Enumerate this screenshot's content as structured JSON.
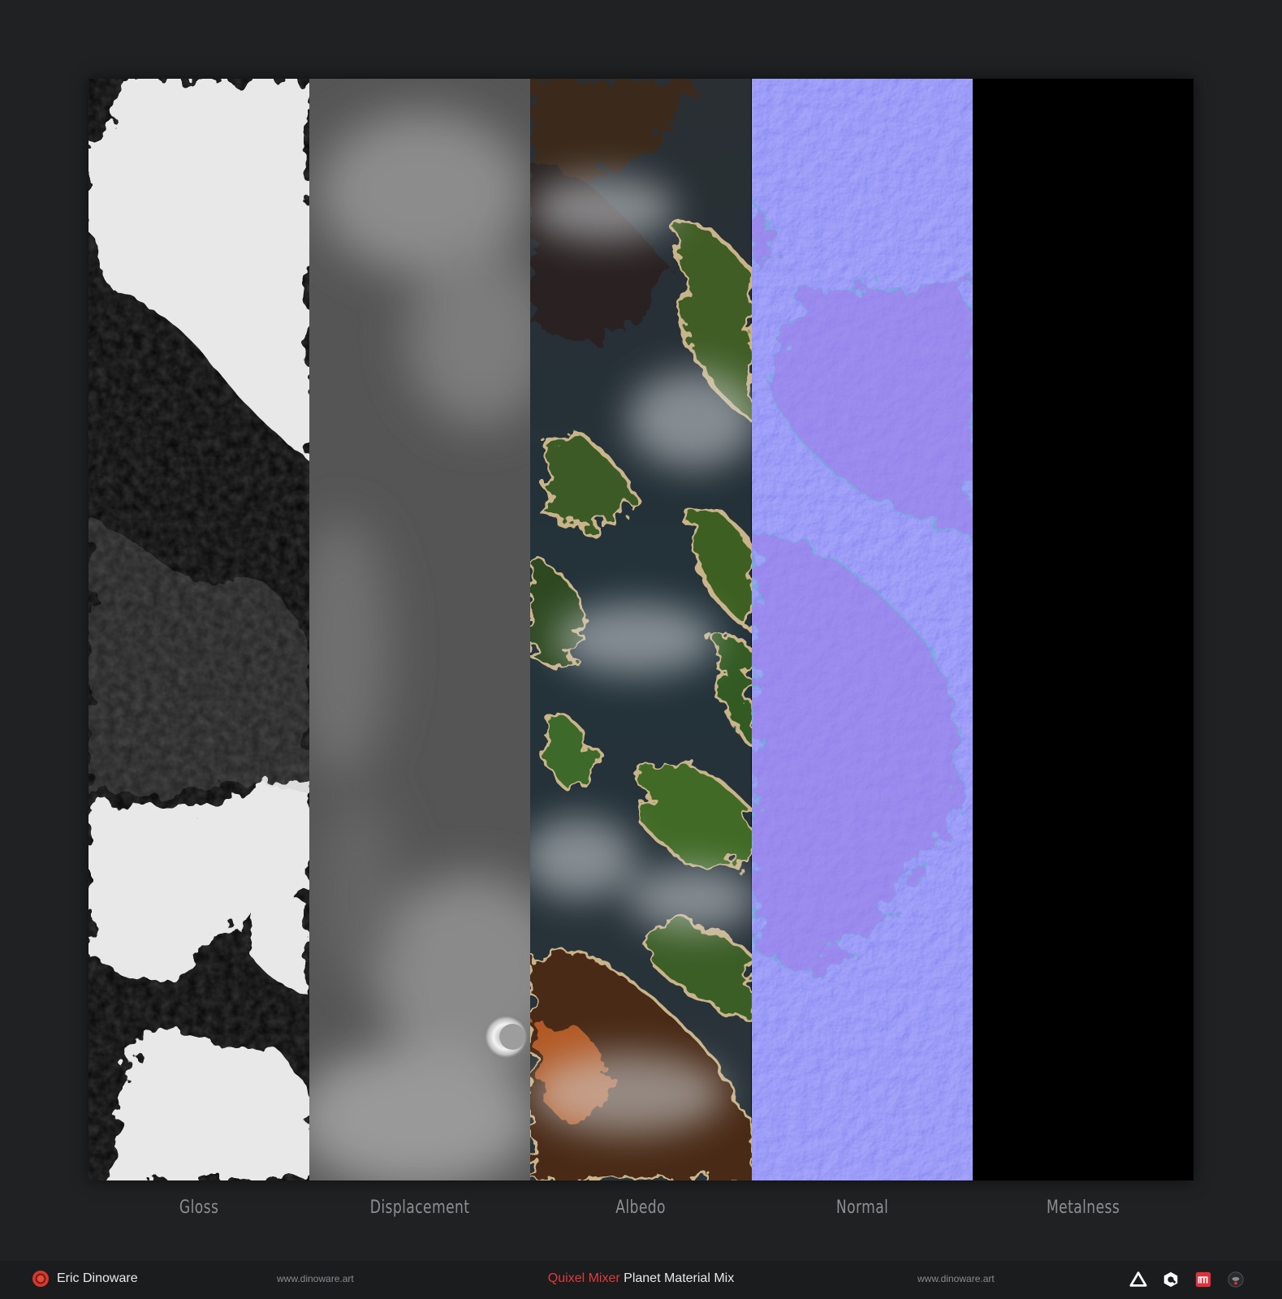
{
  "maps": [
    {
      "label": "Gloss",
      "icon": "gloss-map"
    },
    {
      "label": "Displacement",
      "icon": "displacement-map"
    },
    {
      "label": "Albedo",
      "icon": "albedo-map"
    },
    {
      "label": "Normal",
      "icon": "normal-map"
    },
    {
      "label": "Metalness",
      "icon": "metalness-map"
    }
  ],
  "footer": {
    "author": "Eric Dinoware",
    "url_left": "www.dinoware.art",
    "title_accent": "Quixel Mixer",
    "title_rest": " Planet Material Mix",
    "url_right": "www.dinoware.art",
    "icons": [
      "artstation-icon",
      "quixel-icon",
      "marmoset-icon",
      "dinoware-logo-icon"
    ]
  },
  "colors": {
    "background": "#202123",
    "label": "#8d8e91",
    "accent": "#e03b3b",
    "normal_base": "#7f7ff8"
  }
}
